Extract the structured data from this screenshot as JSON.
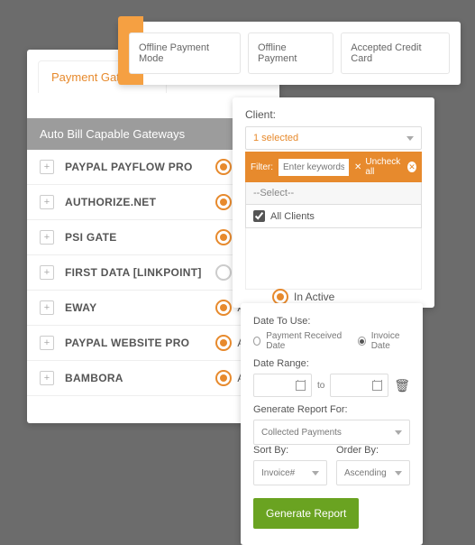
{
  "gateways": {
    "tab": "Payment Gateways",
    "header": "Auto Bill Capable Gateways",
    "active_label": "Active",
    "rows": [
      {
        "name": "PAYPAL PAYFLOW PRO",
        "on": true
      },
      {
        "name": "AUTHORIZE.NET",
        "on": true
      },
      {
        "name": "PSI GATE",
        "on": true
      },
      {
        "name": "FIRST DATA [LINKPOINT]",
        "on": false
      },
      {
        "name": "EWAY",
        "on": true
      },
      {
        "name": "PAYPAL WEBSITE PRO",
        "on": true
      },
      {
        "name": "BAMBORA",
        "on": true
      }
    ]
  },
  "topbar": {
    "items": [
      "Offline Payment Mode",
      "Offline Payment",
      "Accepted Credit Card"
    ]
  },
  "client": {
    "label": "Client:",
    "selected": "1 selected",
    "filter_label": "Filter:",
    "filter_placeholder": "Enter keywords",
    "uncheck": "Uncheck all",
    "placeholder_opt": "--Select--",
    "all": "All Clients"
  },
  "inactive": {
    "label": "In Active"
  },
  "report": {
    "date_to_use": "Date To Use:",
    "opt1": "Payment Received Date",
    "opt2": "Invoice Date",
    "date_range": "Date Range:",
    "to": "to",
    "gen_for": "Generate Report For:",
    "gen_for_val": "Collected Payments",
    "sort_by": "Sort By:",
    "sort_val": "Invoice#",
    "order_by": "Order By:",
    "order_val": "Ascending",
    "button": "Generate Report"
  }
}
